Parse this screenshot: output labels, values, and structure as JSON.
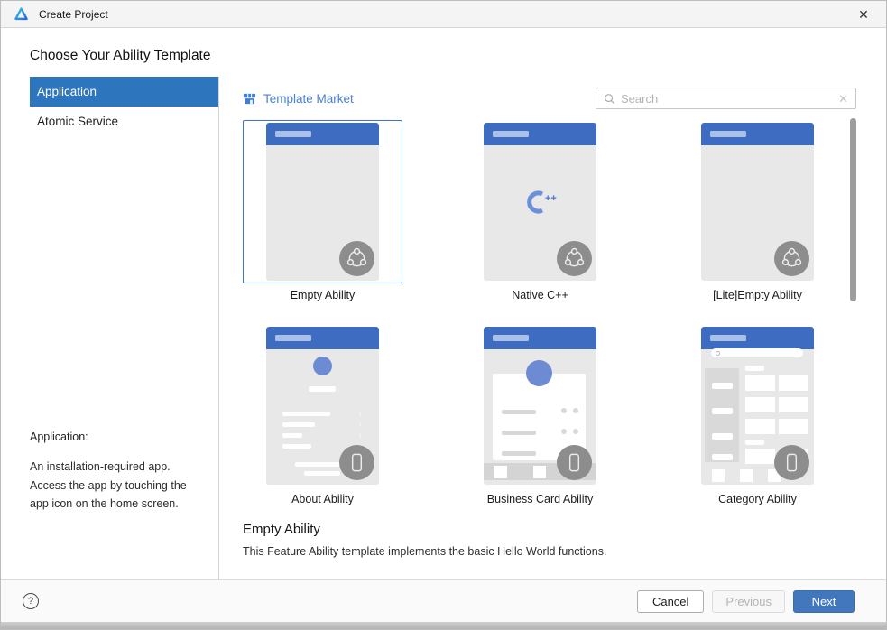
{
  "window": {
    "title": "Create Project",
    "close_glyph": "✕"
  },
  "heading": "Choose Your Ability Template",
  "sidebar": {
    "items": [
      {
        "label": "Application",
        "selected": true
      },
      {
        "label": "Atomic Service",
        "selected": false
      }
    ],
    "info_title": "Application:",
    "info_text": "An installation-required app. Access the app by touching the app icon on the home screen."
  },
  "main": {
    "template_market_label": "Template Market",
    "search": {
      "placeholder": "Search",
      "clear_glyph": "✕"
    },
    "cards": [
      {
        "label": "Empty Ability",
        "selected": true,
        "badge_icon": "harmony-share-icon"
      },
      {
        "label": "Native C++",
        "selected": false,
        "center_plus": "++",
        "badge_icon": "harmony-share-icon"
      },
      {
        "label": "[Lite]Empty Ability",
        "selected": false,
        "badge_icon": "harmony-share-icon"
      },
      {
        "label": "About Ability",
        "selected": false,
        "badge_icon": "phone-icon"
      },
      {
        "label": "Business Card Ability",
        "selected": false,
        "badge_icon": "phone-icon"
      },
      {
        "label": "Category Ability",
        "selected": false,
        "badge_icon": "phone-icon"
      }
    ],
    "description": {
      "title": "Empty Ability",
      "text": "This Feature Ability template implements the basic Hello World functions."
    }
  },
  "footer": {
    "help_glyph": "?",
    "cancel_label": "Cancel",
    "previous_label": "Previous",
    "next_label": "Next"
  },
  "colors": {
    "sidebar_selected": "#2d76bd",
    "card_header_blue": "#3d6cc0",
    "link_blue": "#4a80d8",
    "selected_card_border": "#3f74c2",
    "next_button_blue": "#4377bd",
    "phone_body_gray": "#e8e8e8",
    "badge_gray": "#8d8d8d",
    "avatar_blue": "#6c8bd3"
  }
}
